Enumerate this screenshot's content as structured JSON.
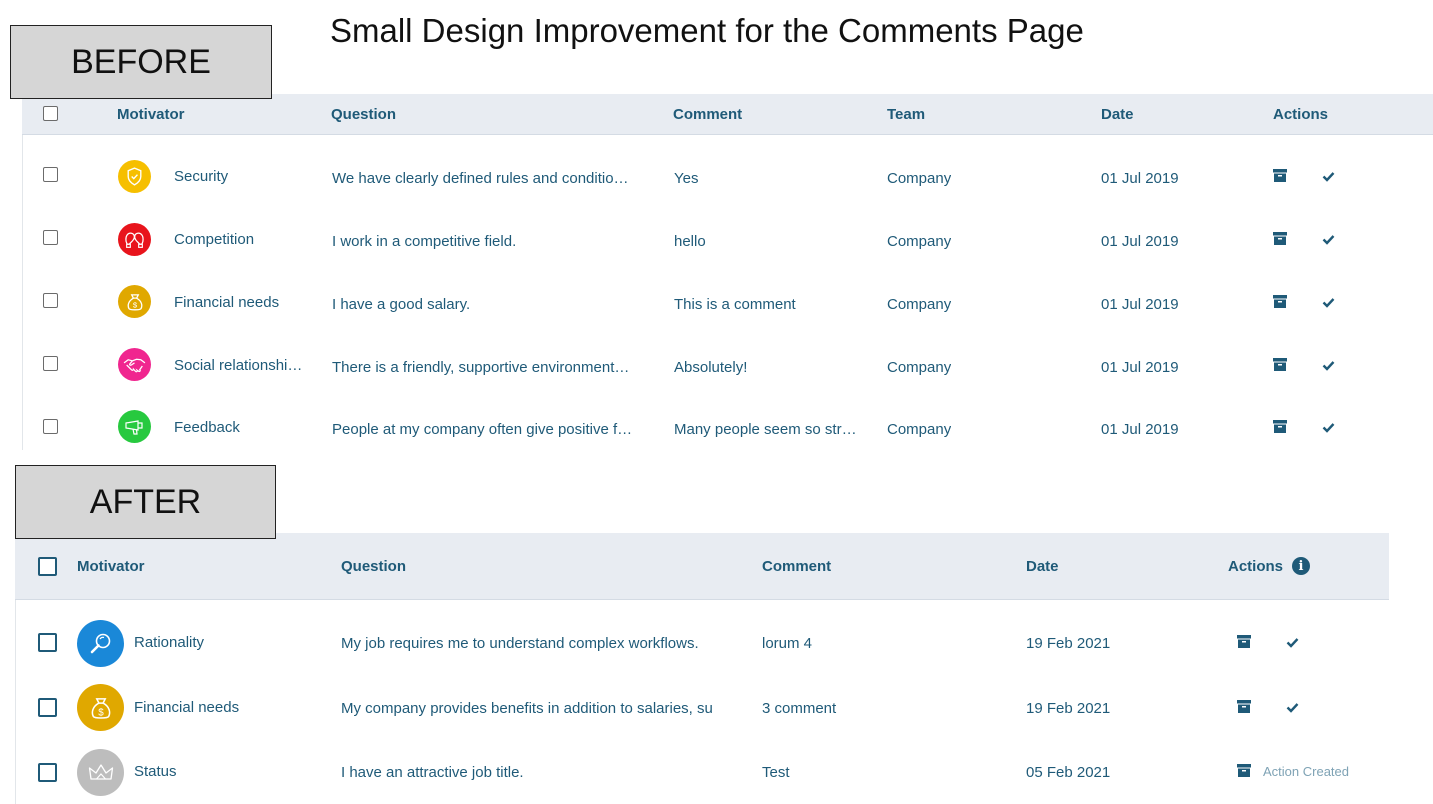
{
  "title": "Small Design Improvement for the Comments Page",
  "before_label": "BEFORE",
  "after_label": "AFTER",
  "colors": {
    "accent": "#1f5a78",
    "header_bg": "#e8ecf2",
    "tag_bg": "#d6d6d6"
  },
  "before": {
    "headers": {
      "motivator": "Motivator",
      "question": "Question",
      "comment": "Comment",
      "team": "Team",
      "date": "Date",
      "actions": "Actions"
    },
    "rows": [
      {
        "motivator": "Security",
        "icon": "shield-icon",
        "color": "#f6bf00",
        "question": "We have clearly defined rules and conditio…",
        "comment": "Yes",
        "team": "Company",
        "date": "01 Jul 2019"
      },
      {
        "motivator": "Competition",
        "icon": "boxing-gloves-icon",
        "color": "#e8141c",
        "question": "I work in a competitive field.",
        "comment": "hello",
        "team": "Company",
        "date": "01 Jul 2019"
      },
      {
        "motivator": "Financial needs",
        "icon": "money-bag-icon",
        "color": "#e0a800",
        "question": "I have a good salary.",
        "comment": "This is a comment",
        "team": "Company",
        "date": "01 Jul 2019"
      },
      {
        "motivator": "Social relationshi…",
        "icon": "handshake-icon",
        "color": "#f0268f",
        "question": "There is a friendly, supportive environment…",
        "comment": "Absolutely!",
        "team": "Company",
        "date": "01 Jul 2019"
      },
      {
        "motivator": "Feedback",
        "icon": "megaphone-icon",
        "color": "#27c93f",
        "question": "People at my company often give positive f…",
        "comment": "Many people seem so str…",
        "team": "Company",
        "date": "01 Jul 2019"
      }
    ]
  },
  "after": {
    "headers": {
      "motivator": "Motivator",
      "question": "Question",
      "comment": "Comment",
      "date": "Date",
      "actions": "Actions"
    },
    "info_glyph": "i",
    "rows": [
      {
        "motivator": "Rationality",
        "icon": "magnifier-icon",
        "color": "#1a88d8",
        "question": "My job requires me to understand complex workflows.",
        "comment": "lorum 4",
        "date": "19 Feb 2021",
        "status": ""
      },
      {
        "motivator": "Financial needs",
        "icon": "money-bag-icon",
        "color": "#e0a800",
        "question": "My company provides benefits in addition to salaries, su",
        "comment": "3 comment",
        "date": "19 Feb 2021",
        "status": ""
      },
      {
        "motivator": "Status",
        "icon": "crown-icon",
        "color": "#bdbdbd",
        "question": "I have an attractive job title.",
        "comment": "Test",
        "date": "05 Feb 2021",
        "status": "Action Created"
      }
    ]
  }
}
